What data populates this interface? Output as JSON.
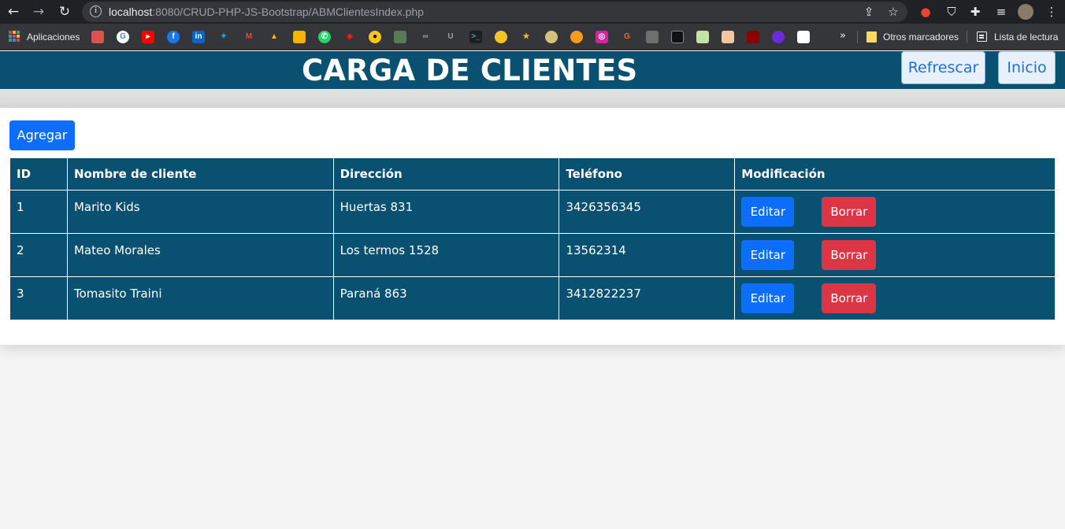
{
  "browser": {
    "url_host": "localhost",
    "url_path": ":8080/CRUD-PHP-JS-Bootstrap/ABMClientesIndex.php",
    "bookmarks": {
      "apps_label": "Aplicaciones",
      "other_label": "Otros marcadores",
      "reading_list_label": "Lista de lectura"
    }
  },
  "header": {
    "title": "CARGA DE CLIENTES",
    "refresh_label": "Refrescar",
    "home_label": "Inicio"
  },
  "toolbar": {
    "add_label": "Agregar"
  },
  "table": {
    "headers": [
      "ID",
      "Nombre de cliente",
      "Dirección",
      "Teléfono",
      "Modificación"
    ],
    "rows": [
      {
        "id": "1",
        "name": "Marito Kids",
        "address": "Huertas 831",
        "phone": "3426356345"
      },
      {
        "id": "2",
        "name": "Mateo Morales",
        "address": "Los termos 1528",
        "phone": "13562314"
      },
      {
        "id": "3",
        "name": "Tomasito Traini",
        "address": "Paraná 863",
        "phone": "3412822237"
      }
    ],
    "edit_label": "Editar",
    "delete_label": "Borrar"
  },
  "colors": {
    "header_bg": "#0a5070",
    "primary": "#0d6efd",
    "danger": "#dc3545"
  }
}
